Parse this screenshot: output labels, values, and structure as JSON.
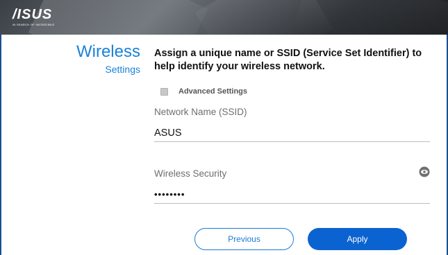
{
  "header": {
    "logo_text": "/ISUS",
    "logo_tagline": "IN SEARCH OF INCREDIBLE"
  },
  "section": {
    "title": "Wireless",
    "subtitle": "Settings"
  },
  "instructions": "Assign a unique name or SSID (Service Set Identifier) to help identify your wireless network.",
  "advanced": {
    "label": "Advanced Settings",
    "checked": false
  },
  "network_name": {
    "label": "Network Name (SSID)",
    "value": "ASUS"
  },
  "wireless_security": {
    "label": "Wireless Security",
    "value": "••••••••",
    "toggle_icon": "eye-icon"
  },
  "buttons": {
    "previous": "Previous",
    "apply": "Apply"
  },
  "colors": {
    "accent": "#1a82d8",
    "primary_button": "#0b63d1",
    "frame_border": "#1a4f8f"
  }
}
